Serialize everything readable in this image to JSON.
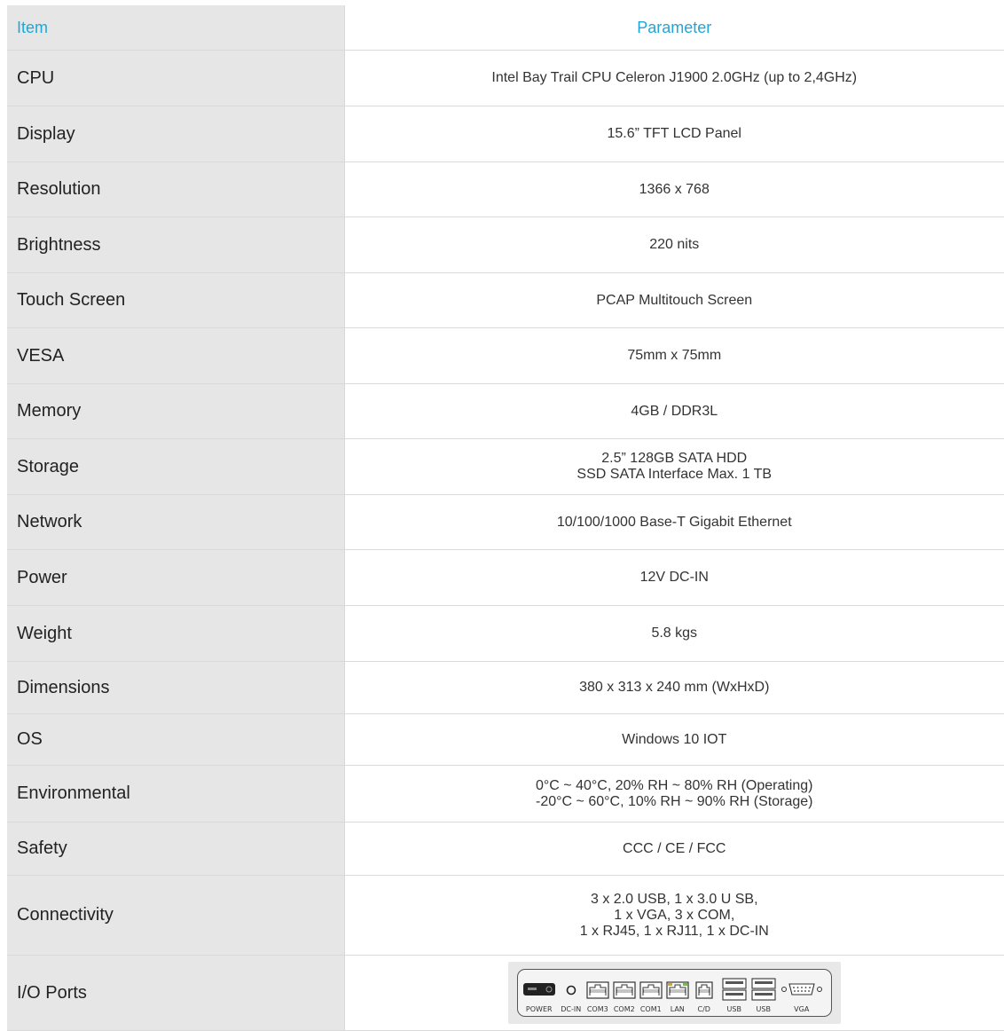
{
  "table": {
    "header": {
      "item": "Item",
      "parameter": "Parameter"
    },
    "rows": [
      {
        "item": "CPU",
        "value": [
          "Intel Bay Trail CPU Celeron J1900 2.0GHz (up to 2,4GHz)"
        ]
      },
      {
        "item": "Display",
        "value": [
          "15.6” TFT LCD Panel"
        ]
      },
      {
        "item": "Resolution",
        "value": [
          "1366 x 768"
        ]
      },
      {
        "item": "Brightness",
        "value": [
          "220 nits"
        ]
      },
      {
        "item": "Touch Screen",
        "value": [
          "PCAP Multitouch Screen"
        ]
      },
      {
        "item": "VESA",
        "value": [
          "75mm x 75mm"
        ]
      },
      {
        "item": "Memory",
        "value": [
          "4GB / DDR3L"
        ]
      },
      {
        "item": "Storage",
        "value": [
          "2.5” 128GB SATA HDD",
          "SSD SATA Interface Max. 1 TB"
        ]
      },
      {
        "item": "Network",
        "value": [
          "10/100/1000 Base-T Gigabit Ethernet"
        ]
      },
      {
        "item": "Power",
        "value": [
          "12V DC-IN"
        ]
      },
      {
        "item": "Weight",
        "value": [
          "5.8 kgs"
        ]
      },
      {
        "item": "Dimensions",
        "value": [
          "380 x 313 x 240 mm (WxHxD)"
        ]
      },
      {
        "item": "OS",
        "value": [
          "Windows 10 IOT"
        ]
      },
      {
        "item": "Environmental",
        "value": [
          "0°C ~ 40°C, 20% RH ~ 80% RH (Operating)",
          "-20°C ~ 60°C, 10% RH ~ 90% RH (Storage)"
        ]
      },
      {
        "item": "Safety",
        "value": [
          "CCC / CE / FCC"
        ]
      },
      {
        "item": "Connectivity",
        "value": [
          "3 x 2.0 USB, 1 x 3.0 U SB,",
          "1 x VGA, 3 x COM,",
          "1 x RJ45, 1 x RJ11, 1 x DC-IN"
        ]
      }
    ],
    "io_row": {
      "item": "I/O Ports",
      "ports": [
        "POWER",
        "DC-IN",
        "COM3",
        "COM2",
        "COM1",
        "LAN",
        "C/D",
        "USB",
        "USB",
        "VGA"
      ]
    }
  },
  "colors": {
    "header_text": "#1ea7d8",
    "item_column_bg": "#e6e6e6",
    "border": "#d9d9d9"
  }
}
